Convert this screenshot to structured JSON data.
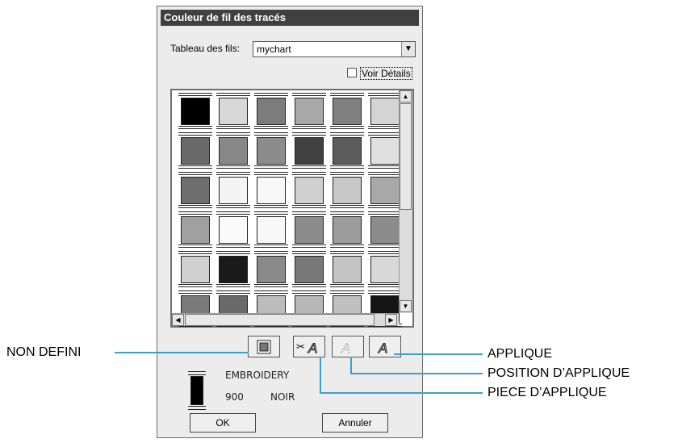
{
  "dialog": {
    "title": "Couleur de fil des tracés",
    "table_label": "Tableau des fils:",
    "table_value": "mychart",
    "details_label": "Voir Détails",
    "ok_label": "OK",
    "cancel_label": "Annuler"
  },
  "swatches": [
    [
      "#000000",
      "#d8d8d8",
      "#7c7c7c",
      "#a8a8a8",
      "#808080",
      "#d4d4d4"
    ],
    [
      "#6a6a6a",
      "#888888",
      "#8c8c8c",
      "#404040",
      "#5c5c5c",
      "#e0e0e0"
    ],
    [
      "#6e6e6e",
      "#f4f4f4",
      "#f8f8f8",
      "#d0d0d0",
      "#c8c8c8",
      "#a8a8a8"
    ],
    [
      "#a0a0a0",
      "#fafafa",
      "#f8f8f8",
      "#8c8c8c",
      "#9c9c9c",
      "#8c8c8c"
    ],
    [
      "#d0d0d0",
      "#1a1a1a",
      "#8a8a8a",
      "#787878",
      "#c4c4c4",
      "#d8d8d8"
    ],
    [
      "#7a7a7a",
      "#6a6a6a",
      "#bcbcbc",
      "#b8b8b8",
      "#c0c0c0",
      "#141414"
    ]
  ],
  "current_thread": {
    "brand": "EMBROIDERY",
    "number": "900",
    "name": "NOIR",
    "color": "#000000"
  },
  "callouts": {
    "undefined": "NON DEFINI",
    "applique": "APPLIQUE",
    "applique_position": "POSITION D’APPLIQUE",
    "applique_piece": "PIECE D’APPLIQUE"
  }
}
